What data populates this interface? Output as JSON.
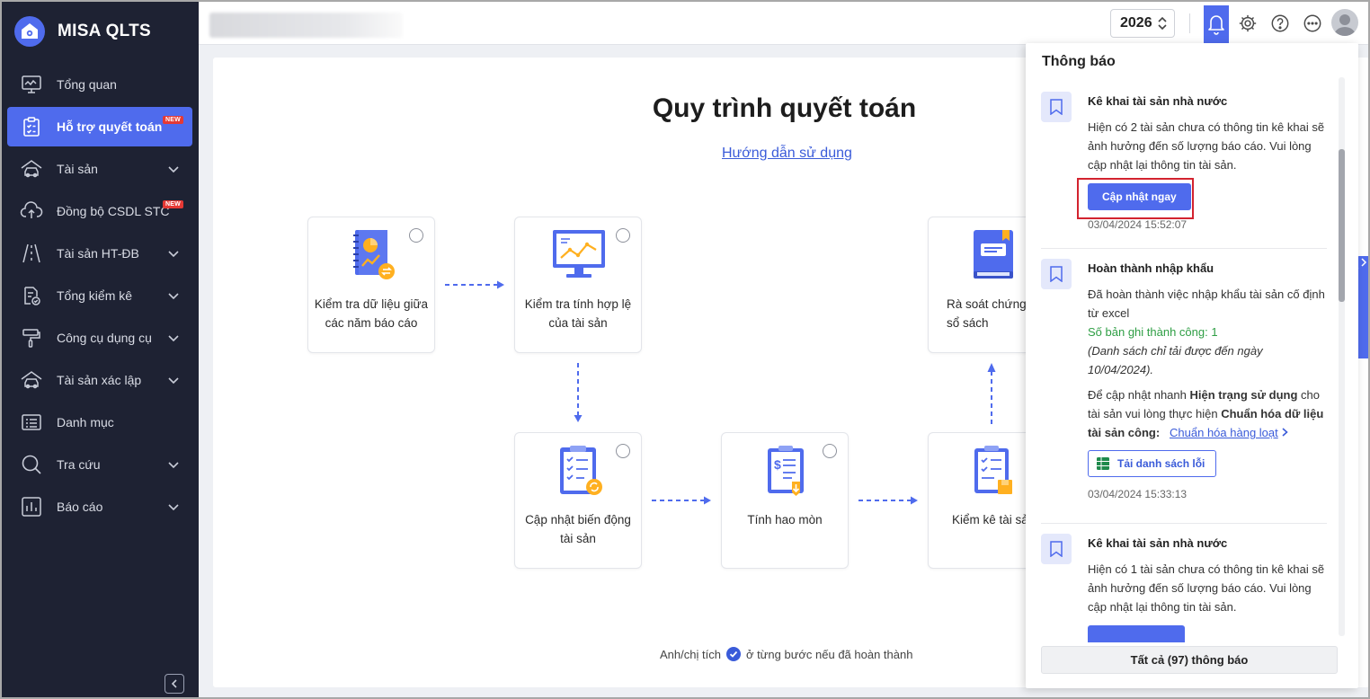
{
  "app": {
    "name": "MISA QLTS"
  },
  "sidebar": {
    "items": [
      {
        "label": "Tổng quan",
        "icon": "monitor-chart-icon",
        "active": false,
        "new": false,
        "expandable": false
      },
      {
        "label": "Hỗ trợ quyết toán",
        "icon": "clipboard-check-icon",
        "active": true,
        "new": true,
        "expandable": false
      },
      {
        "label": "Tài sản",
        "icon": "car-house-icon",
        "active": false,
        "new": false,
        "expandable": true
      },
      {
        "label": "Đồng bộ CSDL STC",
        "icon": "cloud-sync-icon",
        "active": false,
        "new": true,
        "expandable": false
      },
      {
        "label": "Tài sản HT-ĐB",
        "icon": "road-icon",
        "active": false,
        "new": false,
        "expandable": true
      },
      {
        "label": "Tổng kiểm kê",
        "icon": "document-check-icon",
        "active": false,
        "new": false,
        "expandable": true
      },
      {
        "label": "Công cụ dụng cụ",
        "icon": "paint-roller-icon",
        "active": false,
        "new": false,
        "expandable": true
      },
      {
        "label": "Tài sản xác lập",
        "icon": "car-house-icon",
        "active": false,
        "new": false,
        "expandable": true
      },
      {
        "label": "Danh mục",
        "icon": "list-icon",
        "active": false,
        "new": false,
        "expandable": false
      },
      {
        "label": "Tra cứu",
        "icon": "search-icon",
        "active": false,
        "new": false,
        "expandable": true
      },
      {
        "label": "Báo cáo",
        "icon": "bar-chart-icon",
        "active": false,
        "new": false,
        "expandable": true
      }
    ],
    "new_badge": "NEW"
  },
  "topbar": {
    "year": "2026"
  },
  "main": {
    "title": "Quy trình quyết toán",
    "guide_link": "Hướng dẫn sử dụng",
    "steps": [
      {
        "label": "Kiểm tra dữ liệu giữa các năm báo cáo"
      },
      {
        "label": "Kiểm tra tính hợp lệ của tài sản"
      },
      {
        "label": "Rà soát chứng từ sổ sách"
      },
      {
        "label": "Cập nhật biến động tài sản"
      },
      {
        "label": "Tính hao mòn"
      },
      {
        "label": "Kiểm kê tài sản"
      }
    ],
    "hint_before": "Anh/chị tích",
    "hint_after": "ở từng bước nếu đã hoàn thành"
  },
  "notifications": {
    "title": "Thông báo",
    "items": [
      {
        "heading": "Kê khai tài sản nhà nước",
        "text": "Hiện có 2 tài sản chưa có thông tin kê khai sẽ ảnh hưởng đến số lượng báo cáo. Vui lòng cập nhật lại thông tin tài sản.",
        "button": "Cập nhật ngay",
        "time": "03/04/2024 15:52:07"
      },
      {
        "heading": "Hoàn thành nhập khẩu",
        "line1": "Đã hoàn thành việc nhập khẩu tài sản cố định từ excel",
        "success": "Số bản ghi thành công: 1",
        "note": "(Danh sách chỉ tải được đến ngày 10/04/2024).",
        "para_a": "Để cập nhật nhanh ",
        "para_b": "Hiện trạng sử dụng",
        "para_c": " cho tài sản vui lòng thực hiện ",
        "para_d": "Chuẩn hóa dữ liệu tài sản công:",
        "link": "Chuẩn hóa hàng loạt",
        "button": "Tải danh sách lỗi",
        "time": "03/04/2024 15:33:13"
      },
      {
        "heading": "Kê khai tài sản nhà nước",
        "text": "Hiện có 1 tài sản chưa có thông tin kê khai sẽ ảnh hưởng đến số lượng báo cáo. Vui lòng cập nhật lại thông tin tài sản."
      }
    ],
    "all_button": "Tất cả (97) thông báo"
  },
  "colors": {
    "sidebar_bg": "#1e2233",
    "accent": "#4f6bed",
    "highlight_box": "#d3232f",
    "success": "#2e9e44"
  }
}
